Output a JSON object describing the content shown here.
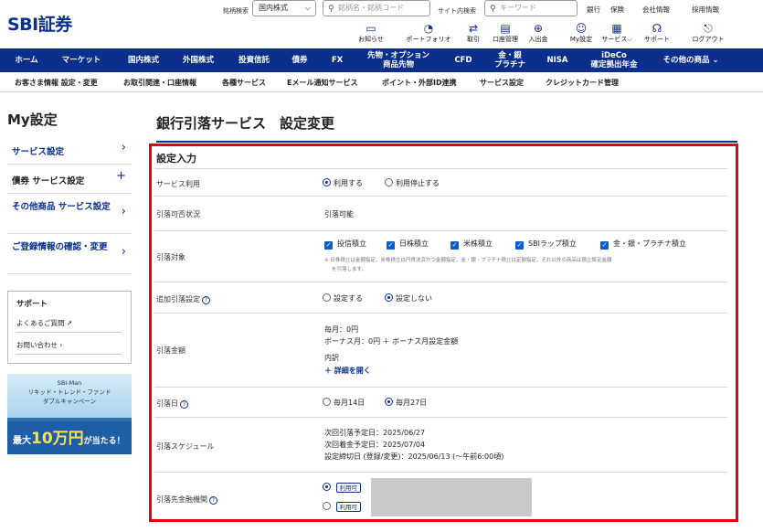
{
  "header": {
    "logo": "SBI証券",
    "stock_search_label": "銘柄検索",
    "stock_market_select": "国内株式",
    "stock_search_placeholder": "銘柄名・銘柄コード",
    "site_search_label": "サイト内検索",
    "site_search_placeholder": "キーワード",
    "links": [
      "銀行",
      "保険",
      "会社情報",
      "採用情報"
    ],
    "icons": [
      {
        "icon": "bell-icon",
        "label": "お知らせ"
      },
      {
        "icon": "pie-chart-icon",
        "label": "ポートフォリオ"
      },
      {
        "icon": "transfer-icon",
        "label": "取引"
      },
      {
        "icon": "account-icon",
        "label": "口座管理"
      },
      {
        "icon": "deposit-icon",
        "label": "入出金"
      },
      {
        "icon": "user-icon",
        "label": "My設定"
      },
      {
        "icon": "services-icon",
        "label": "サービス"
      },
      {
        "icon": "headset-icon",
        "label": "サポート"
      },
      {
        "icon": "logout-icon",
        "label": "ログアウト"
      }
    ]
  },
  "nav": [
    "ホーム",
    "マーケット",
    "国内株式",
    "外国株式",
    "投資信託",
    "債券",
    "FX",
    "先物・オプション\n商品先物",
    "CFD",
    "金・銀\nプラチナ",
    "NISA",
    "iDeCo\n確定拠出年金",
    "その他の商品"
  ],
  "subnav": [
    "お客さま情報 設定・変更",
    "お取引関連・口座情報",
    "各種サービス",
    "Eメール通知サービス",
    "ポイント・外部ID連携",
    "サービス設定",
    "クレジットカード管理"
  ],
  "sidebar": {
    "title": "My設定",
    "items": [
      "サービス設定",
      "債券 サービス設定",
      "その他商品 サービス設定",
      "ご登録情報の確認・変更"
    ],
    "support": {
      "title": "サポート",
      "links": [
        "よくあるご質問",
        "お問い合わせ"
      ]
    },
    "banner": {
      "line1": "SBI-Man",
      "line2": "リキッド・トレンド・ファンド",
      "line3": "ダブルキャンペーン",
      "line4_a": "最大",
      "line4_b": "10万円",
      "line4_c": "が当たる！"
    }
  },
  "main": {
    "title": "銀行引落サービス　設定変更",
    "section": "設定入力",
    "rows": {
      "service": {
        "label": "サービス利用",
        "opt1": "利用する",
        "opt2": "利用停止する"
      },
      "status": {
        "label": "引落可否状況",
        "value": "引落可能"
      },
      "target": {
        "label": "引落対象",
        "items": [
          "投信積立",
          "日株積立",
          "米株積立",
          "SBIラップ積立",
          "金・銀・プラチナ積立"
        ],
        "note1": "※ 日株積立は金額指定、米株積立は円貨決済かつ金額指定、金・銀・プラチナ積立は定額指定、それ以外の商品は積立設定金額",
        "note2": "を引落します。"
      },
      "extra": {
        "label": "追加引落設定",
        "opt1": "設定する",
        "opt2": "設定しない"
      },
      "amount": {
        "label": "引落金額",
        "line1": "毎月：0円",
        "line2": "ボーナス月：0円 ＋ ボーナス月設定金額",
        "line3": "内訳",
        "expand": "詳細を開く"
      },
      "date": {
        "label": "引落日",
        "opt1": "毎月14日",
        "opt2": "毎月27日"
      },
      "schedule": {
        "label": "引落スケジュール",
        "line1": "次回引落予定日：2025/06/27",
        "line2": "次回着金予定日：2025/07/04",
        "line3": "設定締切日 (登録/変更)：2025/06/13 (〜午前6:00頃)"
      },
      "bank": {
        "label": "引落先金融機関",
        "badge": "利用可"
      }
    }
  }
}
